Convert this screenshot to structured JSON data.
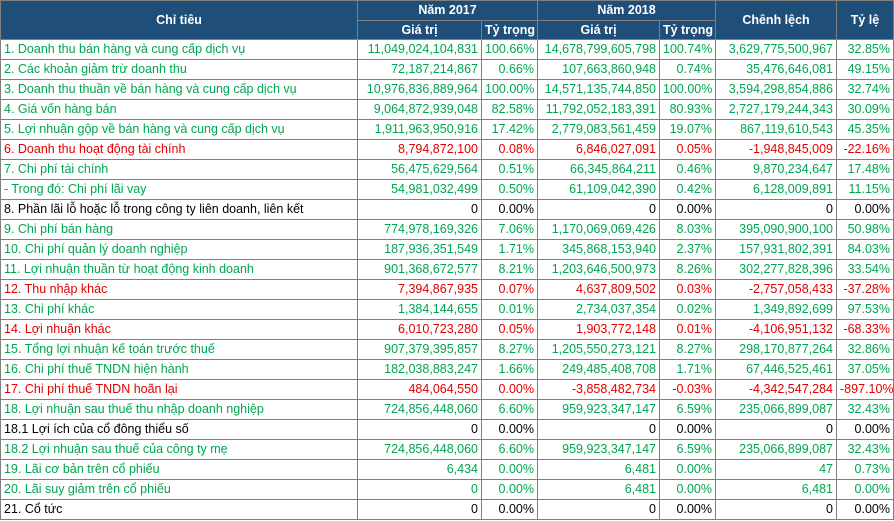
{
  "header": {
    "indicator": "Chỉ tiêu",
    "year1": "Năm 2017",
    "year2": "Năm 2018",
    "diff": "Chênh lệch",
    "ratio": "Tỷ lệ",
    "value": "Giá trị",
    "weight": "Tỷ trọng"
  },
  "rows": [
    {
      "label": "1. Doanh thu bán hàng và cung cấp dịch vụ",
      "v17": "11,049,024,104,831",
      "w17": "100.66%",
      "v18": "14,678,799,605,798",
      "w18": "100.74%",
      "diff": "3,629,775,500,967",
      "ratio": "32.85%",
      "color": "green"
    },
    {
      "label": "2. Các khoản giảm trừ doanh thu",
      "v17": "72,187,214,867",
      "w17": "0.66%",
      "v18": "107,663,860,948",
      "w18": "0.74%",
      "diff": "35,476,646,081",
      "ratio": "49.15%",
      "color": "green"
    },
    {
      "label": "3. Doanh thu thuần về bán hàng và cung cấp dịch vụ",
      "v17": "10,976,836,889,964",
      "w17": "100.00%",
      "v18": "14,571,135,744,850",
      "w18": "100.00%",
      "diff": "3,594,298,854,886",
      "ratio": "32.74%",
      "color": "green"
    },
    {
      "label": "4. Giá vốn hàng bán",
      "v17": "9,064,872,939,048",
      "w17": "82.58%",
      "v18": "11,792,052,183,391",
      "w18": "80.93%",
      "diff": "2,727,179,244,343",
      "ratio": "30.09%",
      "color": "green"
    },
    {
      "label": "5. Lợi nhuận gộp về bán hàng và cung cấp dịch vụ",
      "v17": "1,911,963,950,916",
      "w17": "17.42%",
      "v18": "2,779,083,561,459",
      "w18": "19.07%",
      "diff": "867,119,610,543",
      "ratio": "45.35%",
      "color": "green"
    },
    {
      "label": "6. Doanh thu hoạt động tài chính",
      "v17": "8,794,872,100",
      "w17": "0.08%",
      "v18": "6,846,027,091",
      "w18": "0.05%",
      "diff": "-1,948,845,009",
      "ratio": "-22.16%",
      "color": "red"
    },
    {
      "label": "7. Chi phí tài chính",
      "v17": "56,475,629,564",
      "w17": "0.51%",
      "v18": "66,345,864,211",
      "w18": "0.46%",
      "diff": "9,870,234,647",
      "ratio": "17.48%",
      "color": "green"
    },
    {
      "label": " - Trong đó: Chi phí lãi vay",
      "v17": "54,981,032,499",
      "w17": "0.50%",
      "v18": "61,109,042,390",
      "w18": "0.42%",
      "diff": "6,128,009,891",
      "ratio": "11.15%",
      "color": "green"
    },
    {
      "label": "8. Phần lãi lỗ hoặc lỗ trong công ty liên doanh, liên kết",
      "v17": "0",
      "w17": "0.00%",
      "v18": "0",
      "w18": "0.00%",
      "diff": "0",
      "ratio": "0.00%",
      "color": "black"
    },
    {
      "label": "9. Chi phí bán hàng",
      "v17": "774,978,169,326",
      "w17": "7.06%",
      "v18": "1,170,069,069,426",
      "w18": "8.03%",
      "diff": "395,090,900,100",
      "ratio": "50.98%",
      "color": "green"
    },
    {
      "label": "10. Chi phí quản lý doanh nghiệp",
      "v17": "187,936,351,549",
      "w17": "1.71%",
      "v18": "345,868,153,940",
      "w18": "2.37%",
      "diff": "157,931,802,391",
      "ratio": "84.03%",
      "color": "green"
    },
    {
      "label": "11. Lợi nhuận thuần từ hoạt động kinh doanh",
      "v17": "901,368,672,577",
      "w17": "8.21%",
      "v18": "1,203,646,500,973",
      "w18": "8.26%",
      "diff": "302,277,828,396",
      "ratio": "33.54%",
      "color": "green"
    },
    {
      "label": "12. Thu nhập khác",
      "v17": "7,394,867,935",
      "w17": "0.07%",
      "v18": "4,637,809,502",
      "w18": "0.03%",
      "diff": "-2,757,058,433",
      "ratio": "-37.28%",
      "color": "red"
    },
    {
      "label": "13. Chi phí khác",
      "v17": "1,384,144,655",
      "w17": "0.01%",
      "v18": "2,734,037,354",
      "w18": "0.02%",
      "diff": "1,349,892,699",
      "ratio": "97.53%",
      "color": "green"
    },
    {
      "label": "14. Lợi nhuận khác",
      "v17": "6,010,723,280",
      "w17": "0.05%",
      "v18": "1,903,772,148",
      "w18": "0.01%",
      "diff": "-4,106,951,132",
      "ratio": "-68.33%",
      "color": "red"
    },
    {
      "label": "15. Tổng lợi nhuận kế toán trước thuế",
      "v17": "907,379,395,857",
      "w17": "8.27%",
      "v18": "1,205,550,273,121",
      "w18": "8.27%",
      "diff": "298,170,877,264",
      "ratio": "32.86%",
      "color": "green"
    },
    {
      "label": "16. Chi phí thuế TNDN hiện hành",
      "v17": "182,038,883,247",
      "w17": "1.66%",
      "v18": "249,485,408,708",
      "w18": "1.71%",
      "diff": "67,446,525,461",
      "ratio": "37.05%",
      "color": "green"
    },
    {
      "label": "17. Chi phí thuế TNDN hoãn lại",
      "v17": "484,064,550",
      "w17": "0.00%",
      "v18": "-3,858,482,734",
      "w18": "-0.03%",
      "diff": "-4,342,547,284",
      "ratio": "-897.10%",
      "color": "red"
    },
    {
      "label": "18. Lợi nhuận sau thuế thu nhập doanh nghiệp",
      "v17": "724,856,448,060",
      "w17": "6.60%",
      "v18": "959,923,347,147",
      "w18": "6.59%",
      "diff": "235,066,899,087",
      "ratio": "32.43%",
      "color": "green"
    },
    {
      "label": "18.1 Lợi ích của cổ đông thiểu số",
      "v17": "0",
      "w17": "0.00%",
      "v18": "0",
      "w18": "0.00%",
      "diff": "0",
      "ratio": "0.00%",
      "color": "black"
    },
    {
      "label": "18.2 Lợi nhuận sau thuế của công ty mẹ",
      "v17": "724,856,448,060",
      "w17": "6.60%",
      "v18": "959,923,347,147",
      "w18": "6.59%",
      "diff": "235,066,899,087",
      "ratio": "32.43%",
      "color": "green"
    },
    {
      "label": "19. Lãi cơ bản trên cổ phiếu",
      "v17": "6,434",
      "w17": "0.00%",
      "v18": "6,481",
      "w18": "0.00%",
      "diff": "47",
      "ratio": "0.73%",
      "color": "green"
    },
    {
      "label": "20. Lãi suy giảm trên cổ phiếu",
      "v17": "0",
      "w17": "0.00%",
      "v18": "6,481",
      "w18": "0.00%",
      "diff": "6,481",
      "ratio": "0.00%",
      "color": "green"
    },
    {
      "label": "21. Cổ tức",
      "v17": "0",
      "w17": "0.00%",
      "v18": "0",
      "w18": "0.00%",
      "diff": "0",
      "ratio": "0.00%",
      "color": "black"
    }
  ],
  "colors": {
    "header_bg": "#1f4e79",
    "green": "#00a550",
    "red": "#e00000",
    "black": "#000000"
  }
}
